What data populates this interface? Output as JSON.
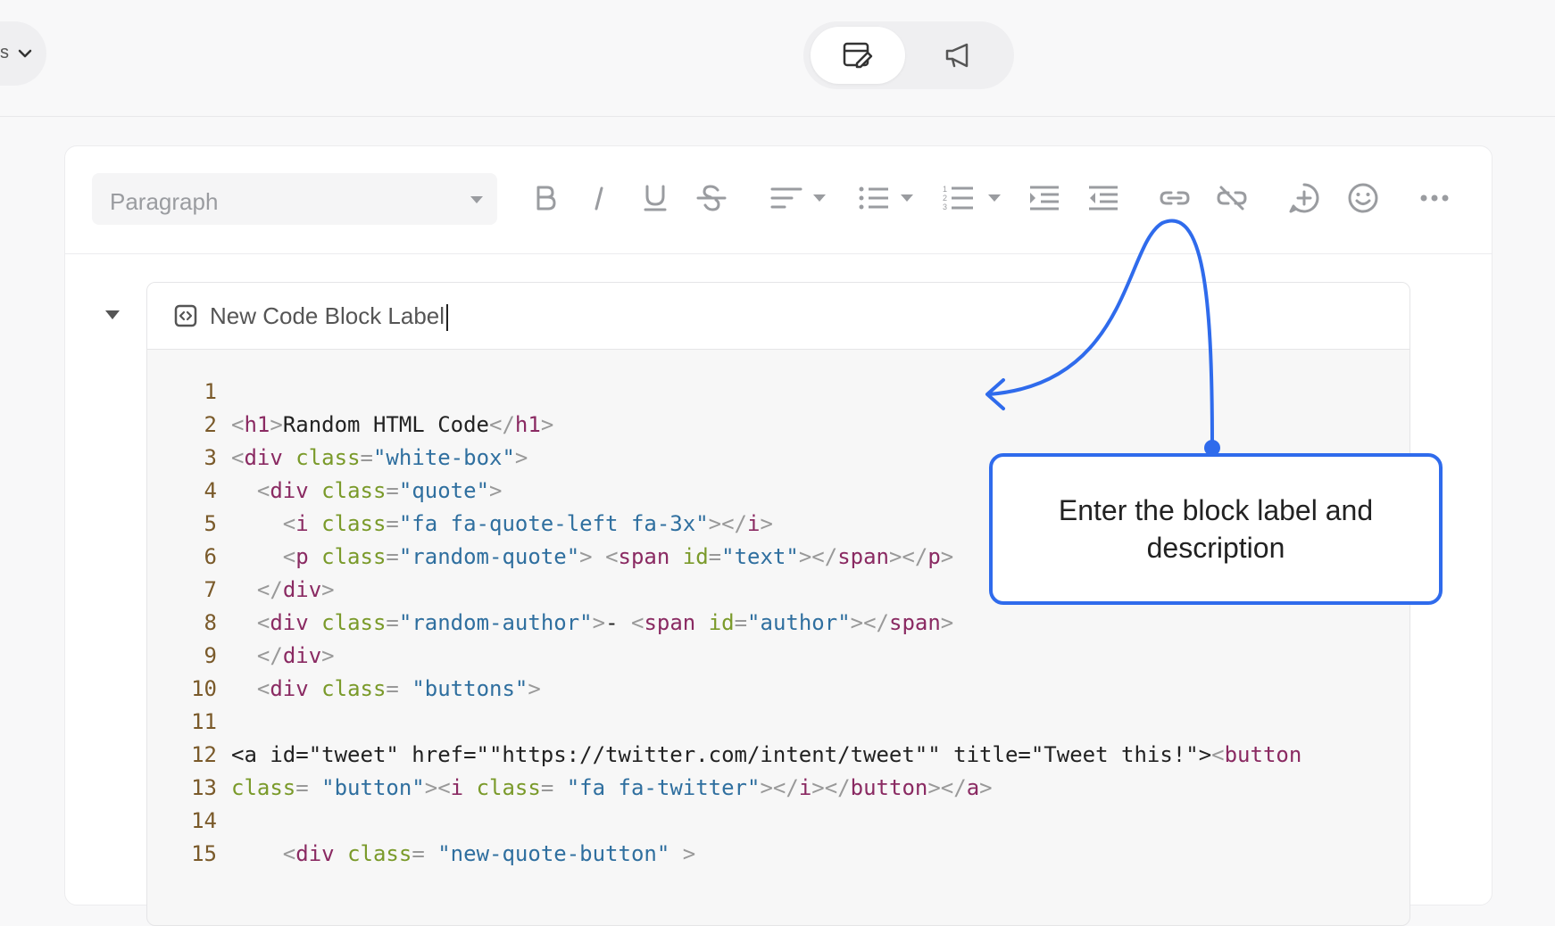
{
  "topbar": {
    "left_fragment": "s",
    "segments": [
      {
        "icon": "edit-document-icon",
        "active": true
      },
      {
        "icon": "megaphone-icon",
        "active": false
      }
    ]
  },
  "toolbar": {
    "paragraph_label": "Paragraph",
    "buttons": [
      "bold-icon",
      "italic-icon",
      "underline-icon",
      "strikethrough-icon",
      "align-icon",
      "bullet-list-icon",
      "numbered-list-icon",
      "indent-icon",
      "outdent-icon",
      "link-icon",
      "unlink-icon",
      "add-embed-icon",
      "emoji-icon",
      "more-icon"
    ]
  },
  "code_block": {
    "label": "New Code Block Label",
    "lines": [
      {
        "n": "1"
      },
      {
        "n": "2"
      },
      {
        "n": "3"
      },
      {
        "n": "4"
      },
      {
        "n": "5"
      },
      {
        "n": "6"
      },
      {
        "n": "7"
      },
      {
        "n": "8"
      },
      {
        "n": "9"
      },
      {
        "n": "10"
      },
      {
        "n": "11"
      },
      {
        "n": "12"
      },
      {
        "n": "13"
      },
      {
        "n": "14"
      },
      {
        "n": "15"
      }
    ]
  },
  "tooltip": {
    "text": "Enter the block label and description"
  },
  "colors": {
    "accent": "#2f6bec",
    "tag": "#8a2a62",
    "attr": "#7a9a2a",
    "string": "#2f6f9f",
    "line_number": "#7a5a2a"
  }
}
